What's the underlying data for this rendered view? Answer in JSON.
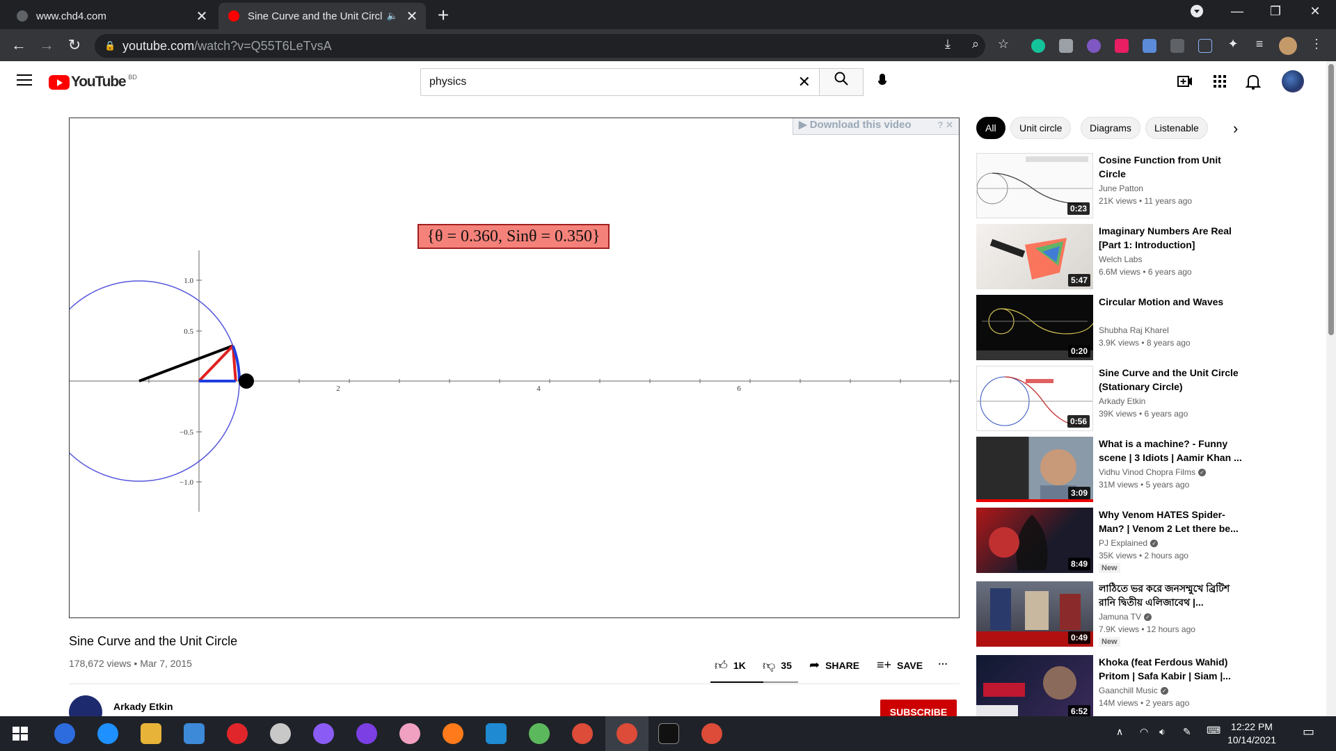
{
  "browser": {
    "tabs": [
      {
        "title": "www.chd4.com",
        "close": "✕"
      },
      {
        "title": "Sine Curve and the Unit Circl",
        "close": "✕"
      }
    ],
    "new_tab": "+",
    "url_host": "youtube.com",
    "url_path": "/watch?v=Q55T6LeTvsA",
    "window_controls": {
      "minimize": "—",
      "maximize": "❐",
      "close": "✕"
    }
  },
  "masthead": {
    "logo_text": "YouTube",
    "country_code": "BD",
    "search_value": "physics",
    "clear_icon": "✕"
  },
  "player": {
    "download_bar": "▶ Download this video",
    "readout": "{θ = 0.360, Sinθ = 0.350}",
    "plot": {
      "theta": 0.36,
      "sin_theta": 0.35,
      "x_ticks": [
        "2",
        "4",
        "6"
      ],
      "y_ticks": [
        "1.0",
        "0.5",
        "−0.5",
        "−1.0"
      ]
    }
  },
  "video": {
    "title": "Sine Curve and the Unit Circle",
    "views": "178,672 views",
    "date": "Mar 7, 2015",
    "likes": "1K",
    "dislikes": "35",
    "like_ratio": 0.6,
    "share": "SHARE",
    "save": "SAVE",
    "more": "⋯",
    "channel": "Arkady Etkin",
    "subscribe": "SUBSCRIBE"
  },
  "chips": [
    "All",
    "Unit circle",
    "Diagrams",
    "Listenable"
  ],
  "recommendations": [
    {
      "title": "Cosine Function from Unit Circle",
      "channel": "June Patton",
      "meta": "21K views • 11 years ago",
      "duration": "0:23",
      "verified": false,
      "new": ""
    },
    {
      "title": "Imaginary Numbers Are Real [Part 1: Introduction]",
      "channel": "Welch Labs",
      "meta": "6.6M views • 6 years ago",
      "duration": "5:47",
      "verified": false,
      "new": ""
    },
    {
      "title": "Circular Motion and Waves",
      "channel": "Shubha Raj Kharel",
      "meta": "3.9K views • 8 years ago",
      "duration": "0:20",
      "verified": false,
      "new": ""
    },
    {
      "title": "Sine Curve and the Unit Circle (Stationary Circle)",
      "channel": "Arkady Etkin",
      "meta": "39K views • 6 years ago",
      "duration": "0:56",
      "verified": false,
      "new": ""
    },
    {
      "title": "What is a machine? - Funny scene | 3 Idiots | Aamir Khan ...",
      "channel": "Vidhu Vinod Chopra Films",
      "meta": "31M views • 5 years ago",
      "duration": "3:09",
      "verified": true,
      "new": ""
    },
    {
      "title": "Why Venom HATES Spider-Man? | Venom 2 Let there be...",
      "channel": "PJ Explained",
      "meta": "35K views • 2 hours ago",
      "duration": "8:49",
      "verified": true,
      "new": "New"
    },
    {
      "title": "লাঠিতে ভর করে জনসম্মুখে ব্রিটিশ রানি দ্বিতীয় এলিজাবেথ |...",
      "channel": "Jamuna TV",
      "meta": "7.9K views • 12 hours ago",
      "duration": "0:49",
      "verified": true,
      "new": "New"
    },
    {
      "title": "Khoka (feat Ferdous Wahid) Pritom | Safa Kabir | Siam |...",
      "channel": "Gaanchill Music",
      "meta": "14M views • 2 years ago",
      "duration": "6:52",
      "verified": true,
      "new": ""
    }
  ],
  "taskbar": {
    "time": "12:22 PM",
    "date": "10/14/2021"
  }
}
